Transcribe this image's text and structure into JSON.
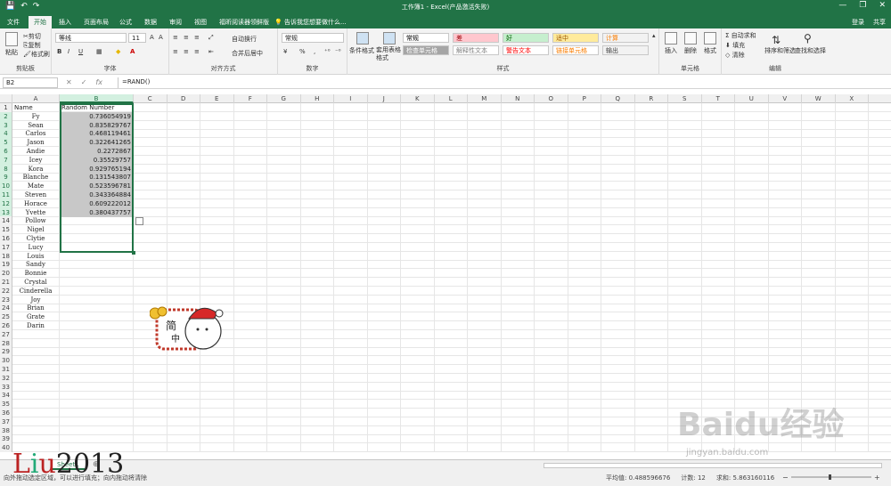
{
  "window": {
    "title": "工作簿1 - Excel(产品激活失败)",
    "qat": [
      "💾",
      "↶",
      "↷"
    ],
    "controls": [
      "—",
      "❐",
      "✕"
    ]
  },
  "tabs": [
    "文件",
    "开始",
    "插入",
    "页面布局",
    "公式",
    "数据",
    "审阅",
    "视图",
    "福昕阅读器领鲜版"
  ],
  "active_tab": "开始",
  "tell_me": "告诉我您想要做什么...",
  "account": {
    "login": "登录",
    "share": "共享"
  },
  "ribbon": {
    "clipboard": {
      "label": "剪贴板",
      "paste": "粘贴",
      "cut": "剪切",
      "copy": "复制",
      "format_painter": "格式刷"
    },
    "font": {
      "label": "字体",
      "font_name": "等线",
      "font_size": "11",
      "bold": "B",
      "italic": "I",
      "underline": "U"
    },
    "alignment": {
      "label": "对齐方式",
      "wrap": "自动换行",
      "merge": "合并后居中"
    },
    "number": {
      "label": "数字",
      "format": "常规",
      "percent": "%"
    },
    "styles": {
      "label": "样式",
      "conditional": "条件格式",
      "table_format": "套用表格格式",
      "cells": [
        {
          "text": "常规",
          "color": "#000000",
          "bg": "#ffffff"
        },
        {
          "text": "差",
          "color": "#9c0006",
          "bg": "#ffc7ce"
        },
        {
          "text": "好",
          "color": "#006100",
          "bg": "#c6efce"
        },
        {
          "text": "适中",
          "color": "#9c5700",
          "bg": "#ffeb9c"
        },
        {
          "text": "计算",
          "color": "#fa7d00",
          "bg": "#f2f2f2"
        },
        {
          "text": "检查单元格",
          "color": "#ffffff",
          "bg": "#a5a5a5"
        },
        {
          "text": "解释性文本",
          "color": "#7f7f7f",
          "bg": "#ffffff"
        },
        {
          "text": "警告文本",
          "color": "#ff0000",
          "bg": "#ffffff"
        },
        {
          "text": "链接单元格",
          "color": "#fa7d00",
          "bg": "#ffffff"
        },
        {
          "text": "输出",
          "color": "#3f3f3f",
          "bg": "#f2f2f2"
        }
      ]
    },
    "cells_group": {
      "label": "单元格",
      "insert": "插入",
      "delete": "删除",
      "format": "格式"
    },
    "editing": {
      "label": "编辑",
      "autosum": "自动求和",
      "fill": "填充",
      "clear": "清除",
      "sort": "排序和筛选",
      "find": "查找和选择"
    }
  },
  "formula_bar": {
    "name_box": "B2",
    "cancel": "✕",
    "enter": "✓",
    "fx": "fx",
    "formula": "=RAND()"
  },
  "columns": [
    "A",
    "B",
    "C",
    "D",
    "E",
    "F",
    "G",
    "H",
    "I",
    "J",
    "K",
    "L",
    "M",
    "N",
    "O",
    "P",
    "Q",
    "R",
    "S",
    "T",
    "U",
    "V",
    "W",
    "X"
  ],
  "selected_column": "B",
  "header_row": {
    "a": "Name",
    "b": "Random Number"
  },
  "names": [
    "Fy",
    "Sean",
    "Carlos",
    "Jason",
    "Andie",
    "Icey",
    "Kora",
    "Blanche",
    "Mate",
    "Steven",
    "Horace",
    "Yvette",
    "Pollow",
    "Nigel",
    "Clytie",
    "Lucy",
    "Louis",
    "Sandy",
    "Bonnie",
    "Crystal",
    "Cinderella",
    "Joy",
    "Brian",
    "Grate",
    "Darin"
  ],
  "random_numbers": [
    "0.736054919",
    "0.835829767",
    "0.468119461",
    "0.322641265",
    "0.2272867",
    "0.35529757",
    "0.929765194",
    "0.131543807",
    "0.523596781",
    "0.343364884",
    "0.609222012",
    "0.380437757"
  ],
  "total_rows": 40,
  "sheet_tab": "Sheet1",
  "add_sheet": "⊕",
  "status": {
    "message": "向外拖动选定区域，可以进行填充；向内拖动将清除",
    "average": "平均值: 0.488596676",
    "count": "计数: 12",
    "sum": "求和: 5.863160116"
  },
  "watermark": {
    "l1": "L",
    "l2": "i",
    "l3": "u",
    "year": "2013"
  },
  "baidu": {
    "logo": "Baidu经验",
    "url": "jingyan.baidu.com"
  },
  "sticker": {
    "char1": "简",
    "char2": "中"
  },
  "colors": {
    "accent": "#217346",
    "highlight": "#c8c8c8"
  }
}
